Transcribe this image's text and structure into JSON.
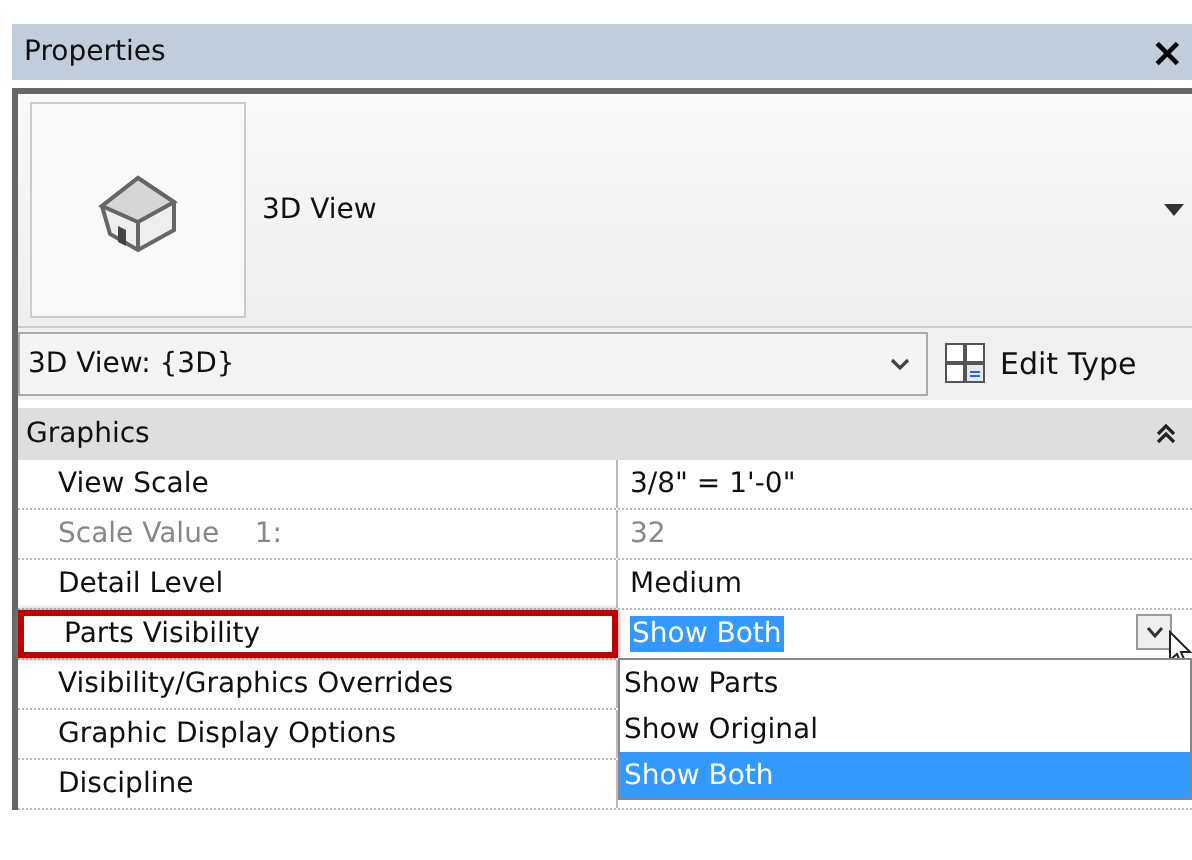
{
  "panel": {
    "title": "Properties",
    "close": "×"
  },
  "type_preview": {
    "name": "3D View"
  },
  "type_selector": {
    "value": "3D View: {3D}",
    "edit_type": "Edit Type"
  },
  "section": {
    "title": "Graphics",
    "expanded": true
  },
  "rows": [
    {
      "label": "View Scale",
      "value": "3/8\" = 1'-0\"",
      "kind": "text",
      "disabled": false,
      "highlighted": false
    },
    {
      "label": "Scale Value    1:",
      "value": "32",
      "kind": "text",
      "disabled": true,
      "highlighted": false
    },
    {
      "label": "Detail Level",
      "value": "Medium",
      "kind": "text",
      "disabled": false,
      "highlighted": false
    },
    {
      "label": "Parts Visibility",
      "value": "Show Both",
      "kind": "dropdown",
      "disabled": false,
      "highlighted": true
    },
    {
      "label": "Visibility/Graphics Overrides",
      "kind": "text",
      "disabled": false,
      "highlighted": false
    },
    {
      "label": "Graphic Display Options",
      "kind": "text",
      "disabled": false,
      "highlighted": false
    },
    {
      "label": "Discipline",
      "kind": "text",
      "disabled": false,
      "highlighted": false
    }
  ],
  "dropdown": {
    "options": [
      {
        "label": "Show Parts",
        "selected": false
      },
      {
        "label": "Show Original",
        "selected": false
      },
      {
        "label": "Show Both",
        "selected": true
      }
    ]
  }
}
